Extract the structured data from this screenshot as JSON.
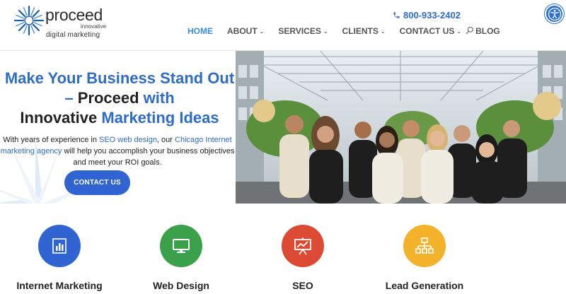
{
  "logo": {
    "name": "proceed",
    "sub": "innovative",
    "tagline": "digital marketing"
  },
  "phone": "800-933-2402",
  "nav": {
    "items": [
      {
        "label": "HOME",
        "dropdown": false,
        "active": true
      },
      {
        "label": "ABOUT",
        "dropdown": true,
        "active": false
      },
      {
        "label": "SERVICES",
        "dropdown": true,
        "active": false
      },
      {
        "label": "CLIENTS",
        "dropdown": true,
        "active": false
      },
      {
        "label": "CONTACT US",
        "dropdown": true,
        "active": false
      },
      {
        "label": "BLOG",
        "dropdown": false,
        "active": false
      }
    ]
  },
  "hero": {
    "title_part1": "Make Your Business Stand Out – ",
    "title_part2": "Proceed",
    "title_part3": " with ",
    "title_part4": "Innovative",
    "title_part5": " Marketing Ideas",
    "body_part1": "With years of experience in ",
    "body_link1": "SEO web design",
    "body_part2": ", our ",
    "body_link2": "Chicago Internet marketing agency",
    "body_part3": " will help you accomplish your business objectives and meet your ROI goals.",
    "cta": "CONTACT US"
  },
  "services": [
    {
      "label": "Internet Marketing",
      "color": "#2f64d2",
      "icon": "bar-chart-icon"
    },
    {
      "label": "Web Design",
      "color": "#3aa04a",
      "icon": "monitor-icon"
    },
    {
      "label": "SEO",
      "color": "#dd4a33",
      "icon": "presentation-chart-icon"
    },
    {
      "label": "Lead Generation",
      "color": "#f4b22b",
      "icon": "org-chart-icon"
    }
  ],
  "colors": {
    "accent": "#2f6cc5",
    "nav_active": "#3b8edb",
    "button": "#2f64d2",
    "accessibility": "#2a6fd6"
  }
}
